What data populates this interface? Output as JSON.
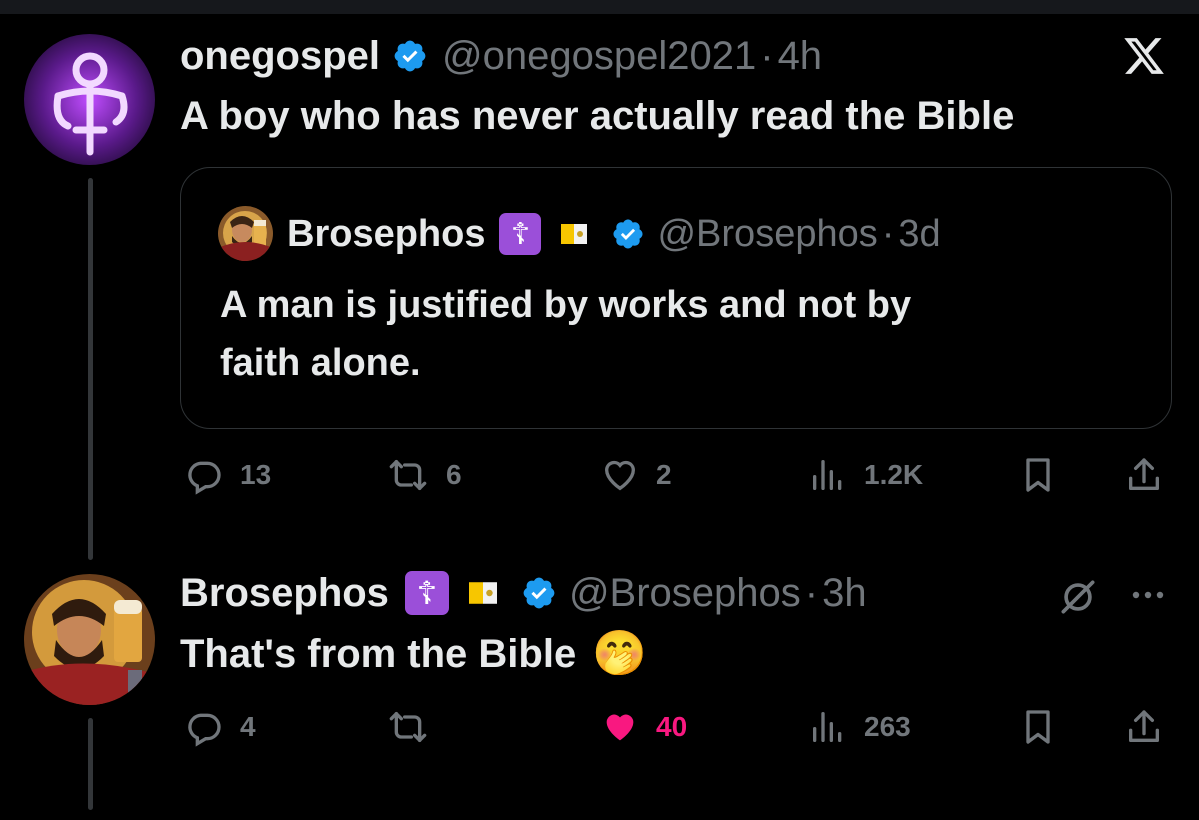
{
  "main_tweet": {
    "display_name": "onegospel",
    "handle": "@onegospel2021",
    "separator": "·",
    "time": "4h",
    "text": "A boy who has never actually read the Bible",
    "quoted": {
      "display_name": "Brosephos",
      "cross_badge": "☦",
      "handle": "@Brosephos",
      "separator": "·",
      "time": "3d",
      "text_line1": "A man is justified by works and not by",
      "text_line2": "faith alone."
    },
    "stats": {
      "replies": "13",
      "reposts": "6",
      "likes": "2",
      "views": "1.2K"
    }
  },
  "reply_tweet": {
    "display_name": "Brosephos",
    "cross_badge": "☦",
    "handle": "@Brosephos",
    "separator": "·",
    "time": "3h",
    "text": "That's from the Bible",
    "emoji": "🤭",
    "stats": {
      "replies": "4",
      "reposts": "",
      "likes": "40",
      "views": "263"
    },
    "liked": true
  },
  "colors": {
    "background": "#000000",
    "text_primary": "#e7e9ea",
    "text_secondary": "#71767b",
    "verified_blue": "#1d9bf0",
    "like_pink": "#f91880",
    "border": "#2f3336",
    "badge_purple": "#9b4fd9"
  },
  "icons": [
    "x-logo-icon",
    "verified-icon",
    "reply-icon",
    "repost-icon",
    "heart-icon",
    "views-icon",
    "bookmark-icon",
    "share-icon",
    "grok-icon",
    "more-icon"
  ]
}
